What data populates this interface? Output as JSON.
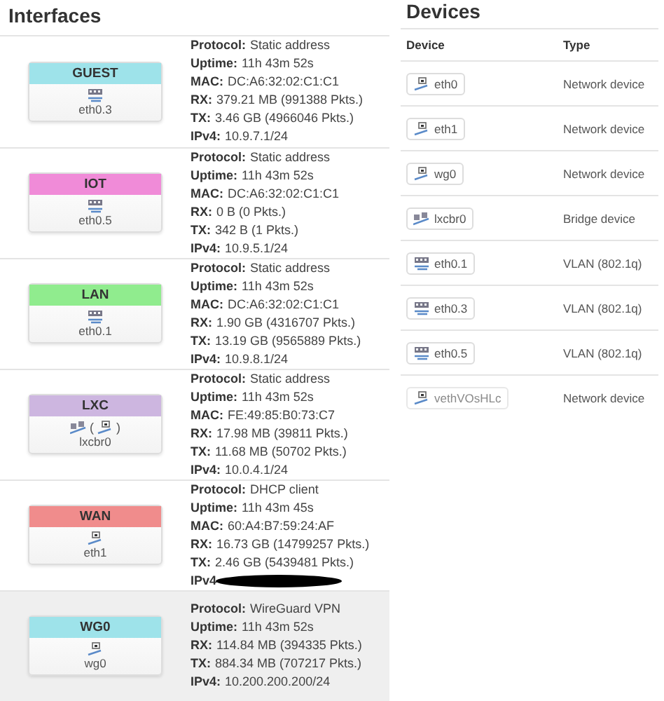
{
  "interfaces": {
    "title": "Interfaces",
    "rows": [
      {
        "name": "GUEST",
        "color": "#9ee3ea",
        "highlighted": false,
        "icons": [
          {
            "kind": "vlan"
          }
        ],
        "device": "eth0.3",
        "stats": [
          {
            "label": "Protocol:",
            "value": "Static address"
          },
          {
            "label": "Uptime:",
            "value": "11h 43m 52s"
          },
          {
            "label": "MAC:",
            "value": "DC:A6:32:02:C1:C1"
          },
          {
            "label": "RX:",
            "value": "379.21 MB (991388 Pkts.)"
          },
          {
            "label": "TX:",
            "value": "3.46 GB (4966046 Pkts.)"
          },
          {
            "label": "IPv4:",
            "value": "10.9.7.1/24"
          }
        ]
      },
      {
        "name": "IOT",
        "color": "#f08bd8",
        "highlighted": false,
        "icons": [
          {
            "kind": "vlan"
          }
        ],
        "device": "eth0.5",
        "stats": [
          {
            "label": "Protocol:",
            "value": "Static address"
          },
          {
            "label": "Uptime:",
            "value": "11h 43m 52s"
          },
          {
            "label": "MAC:",
            "value": "DC:A6:32:02:C1:C1"
          },
          {
            "label": "RX:",
            "value": "0 B (0 Pkts.)"
          },
          {
            "label": "TX:",
            "value": "342 B (1 Pkts.)"
          },
          {
            "label": "IPv4:",
            "value": "10.9.5.1/24"
          }
        ]
      },
      {
        "name": "LAN",
        "color": "#90ec8e",
        "highlighted": false,
        "icons": [
          {
            "kind": "vlan"
          }
        ],
        "device": "eth0.1",
        "stats": [
          {
            "label": "Protocol:",
            "value": "Static address"
          },
          {
            "label": "Uptime:",
            "value": "11h 43m 52s"
          },
          {
            "label": "MAC:",
            "value": "DC:A6:32:02:C1:C1"
          },
          {
            "label": "RX:",
            "value": "1.90 GB (4316707 Pkts.)"
          },
          {
            "label": "TX:",
            "value": "13.19 GB (9565889 Pkts.)"
          },
          {
            "label": "IPv4:",
            "value": "10.9.8.1/24"
          }
        ]
      },
      {
        "name": "LXC",
        "color": "#cdb6e0",
        "highlighted": false,
        "icons": [
          {
            "kind": "bridge"
          },
          {
            "kind": "ethernet",
            "open": "(",
            "close": ")"
          }
        ],
        "device": "lxcbr0",
        "stats": [
          {
            "label": "Protocol:",
            "value": "Static address"
          },
          {
            "label": "Uptime:",
            "value": "11h 43m 52s"
          },
          {
            "label": "MAC:",
            "value": "FE:49:85:B0:73:C7"
          },
          {
            "label": "RX:",
            "value": "17.98 MB (39811 Pkts.)"
          },
          {
            "label": "TX:",
            "value": "11.68 MB (50702 Pkts.)"
          },
          {
            "label": "IPv4:",
            "value": "10.0.4.1/24"
          }
        ]
      },
      {
        "name": "WAN",
        "color": "#f08c8c",
        "highlighted": false,
        "icons": [
          {
            "kind": "ethernet"
          }
        ],
        "device": "eth1",
        "stats": [
          {
            "label": "Protocol:",
            "value": "DHCP client"
          },
          {
            "label": "Uptime:",
            "value": "11h 43m 45s"
          },
          {
            "label": "MAC:",
            "value": "60:A4:B7:59:24:AF"
          },
          {
            "label": "RX:",
            "value": "16.73 GB (14799257 Pkts.)"
          },
          {
            "label": "TX:",
            "value": "2.46 GB (5439481 Pkts.)"
          },
          {
            "label": "IPv4",
            "redacted": true
          }
        ]
      },
      {
        "name": "WG0",
        "color": "#9ee3ea",
        "highlighted": true,
        "icons": [
          {
            "kind": "ethernet"
          }
        ],
        "device": "wg0",
        "stats": [
          {
            "label": "Protocol:",
            "value": "WireGuard VPN"
          },
          {
            "label": "Uptime:",
            "value": "11h 43m 52s"
          },
          {
            "label": "RX:",
            "value": "114.84 MB (394335 Pkts.)"
          },
          {
            "label": "TX:",
            "value": "884.34 MB (707217 Pkts.)"
          },
          {
            "label": "IPv4:",
            "value": "10.200.200.200/24"
          }
        ]
      }
    ]
  },
  "devices": {
    "title": "Devices",
    "columns": [
      "Device",
      "Type"
    ],
    "rows": [
      {
        "name": "eth0",
        "kind": "ethernet",
        "disabled": false,
        "type": "Network device"
      },
      {
        "name": "eth1",
        "kind": "ethernet",
        "disabled": false,
        "type": "Network device"
      },
      {
        "name": "wg0",
        "kind": "ethernet",
        "disabled": false,
        "type": "Network device"
      },
      {
        "name": "lxcbr0",
        "kind": "bridge",
        "disabled": false,
        "type": "Bridge device"
      },
      {
        "name": "eth0.1",
        "kind": "vlan",
        "disabled": false,
        "type": "VLAN (802.1q)"
      },
      {
        "name": "eth0.3",
        "kind": "vlan",
        "disabled": false,
        "type": "VLAN (802.1q)"
      },
      {
        "name": "eth0.5",
        "kind": "vlan",
        "disabled": false,
        "type": "VLAN (802.1q)"
      },
      {
        "name": "vethVOsHLc",
        "kind": "ethernet",
        "disabled": true,
        "type": "Network device"
      }
    ]
  }
}
